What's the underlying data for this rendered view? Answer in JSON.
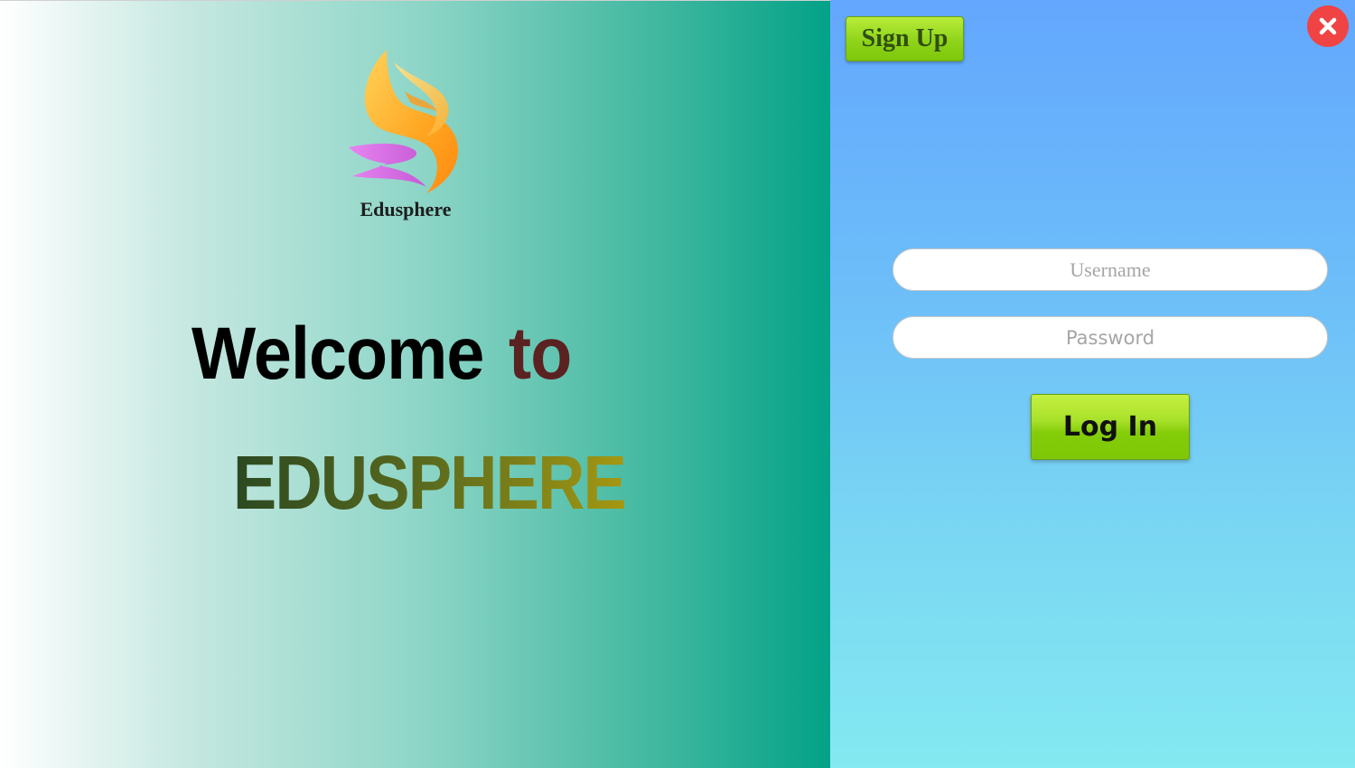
{
  "colors": {
    "left_gradient_start": "#ffffff",
    "left_gradient_end": "#03a287",
    "right_gradient_top": "#63a7fe",
    "right_gradient_bottom": "#84e9f1",
    "button_green": "#8fd41a",
    "close_red": "#f04444",
    "to_text": "#5b2222"
  },
  "brand": {
    "logo_icon": "flame-swirl-logo-icon",
    "logo_text": "Edusphere"
  },
  "hero": {
    "welcome": "Welcome",
    "to": "to",
    "brand_name": "EDUSPHERE"
  },
  "header": {
    "signup_label": "Sign Up",
    "close_icon": "close-icon"
  },
  "login_form": {
    "username_placeholder": "Username",
    "username_value": "",
    "password_placeholder": "Password",
    "password_value": "",
    "login_label": "Log In"
  }
}
